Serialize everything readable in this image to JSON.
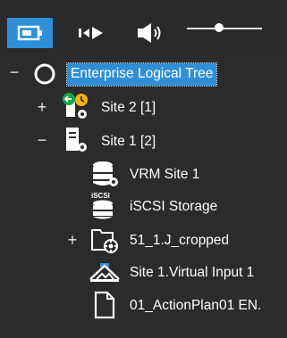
{
  "toolbar": {
    "buttons": [
      {
        "icon": "camera-icon",
        "active": true
      },
      {
        "icon": "playback-icon"
      },
      {
        "icon": "speaker-icon"
      }
    ],
    "volume_level": 0.43
  },
  "tree": {
    "root": {
      "label": "Enterprise Logical Tree",
      "icon": "circle-icon",
      "expander": "−",
      "selected": true
    },
    "site2": {
      "label": "Site 2 [1]",
      "icon": "site-status-icon",
      "expander": "+"
    },
    "site1": {
      "label": "Site 1 [2]",
      "icon": "server-icon",
      "expander": "−"
    },
    "children": [
      {
        "label": "VRM Site 1",
        "icon": "vrm-database-icon",
        "expander": ""
      },
      {
        "label": "iSCSI Storage",
        "icon": "iscsi-storage-icon",
        "icon_text": "iSCSI",
        "expander": ""
      },
      {
        "label": "51_1.J_cropped",
        "icon": "folder-camera-icon",
        "expander": "+"
      },
      {
        "label": "Site 1.Virtual Input 1",
        "icon": "virtual-input-icon",
        "expander": ""
      },
      {
        "label": "01_ActionPlan01 EN.",
        "icon": "document-icon",
        "expander": ""
      }
    ]
  },
  "colors": {
    "background": "#2b2b2b",
    "accent": "#2f8fd6",
    "status_green": "#1aa34a",
    "status_yellow": "#f5b21a"
  }
}
